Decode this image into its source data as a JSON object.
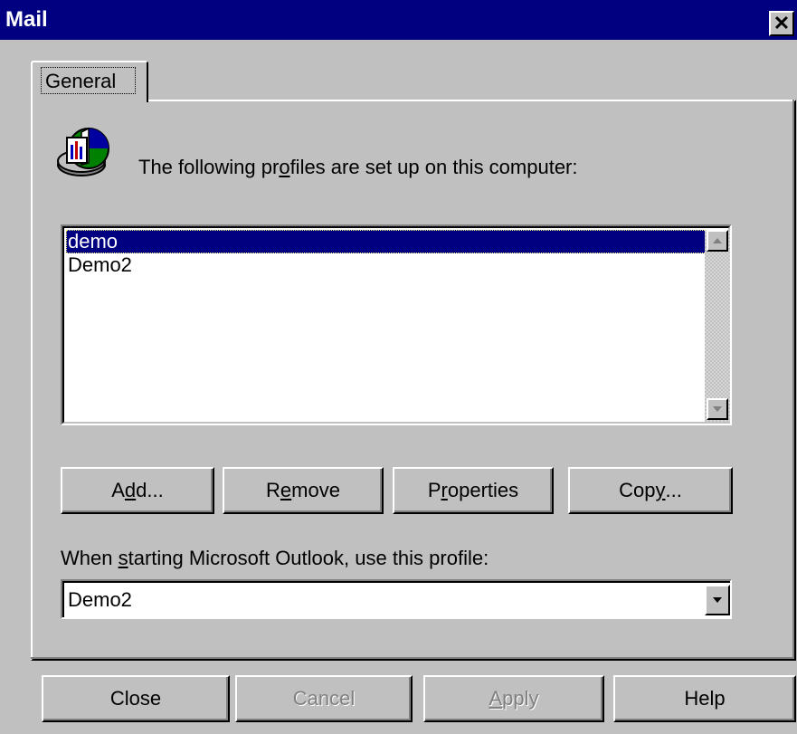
{
  "window": {
    "title": "Mail",
    "close_glyph": "✕"
  },
  "tabs": [
    {
      "label": "General",
      "selected": true
    }
  ],
  "general": {
    "intro_text_pre": "The following pr",
    "intro_text_mnemonic": "o",
    "intro_text_post": "files are set up on this computer:",
    "profiles_icon": "mail-profiles-icon",
    "profiles": [
      {
        "name": "demo",
        "selected": true
      },
      {
        "name": "Demo2",
        "selected": false
      }
    ],
    "buttons": {
      "add": {
        "pre": "A",
        "key": "d",
        "post": "d..."
      },
      "remove": {
        "pre": "R",
        "key": "e",
        "post": "move"
      },
      "properties": {
        "pre": "P",
        "key": "r",
        "post": "operties"
      },
      "copy": {
        "pre": "Cop",
        "key": "y",
        "post": "..."
      }
    },
    "startup_label_pre": "When ",
    "startup_label_key": "s",
    "startup_label_post": "tarting Microsoft Outlook, use this profile:",
    "startup_profile": "Demo2"
  },
  "footer": {
    "close": "Close",
    "cancel": "Cancel",
    "apply_key": "A",
    "apply_rest": "pply",
    "help": "Help",
    "cancel_disabled": true,
    "apply_disabled": true
  },
  "colors": {
    "titlebar": "#000080",
    "face": "#c0c0c0",
    "selection": "#000080"
  }
}
